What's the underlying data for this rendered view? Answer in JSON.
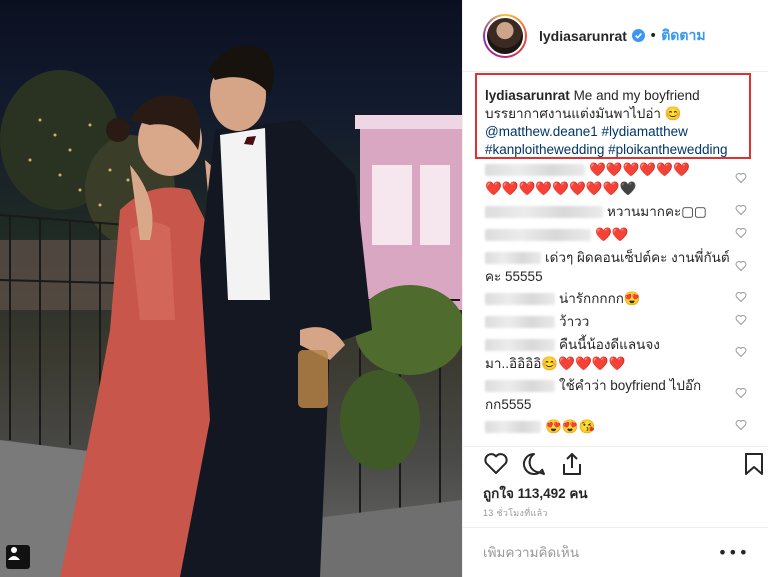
{
  "post": {
    "username": "lydiasarunrat",
    "follow_label": "ติดตาม",
    "separator": "•",
    "caption": {
      "author": "lydiasarunrat",
      "line1": "Me and my boyfriend",
      "line2": "บรรยากาศงานแต่งมันพาไปอ่า 😊",
      "mention1": "@matthew.deane1",
      "tag1": "#lydiamatthew",
      "tag2": "#kanploithewedding",
      "tag3": "#ploikanthewedding"
    },
    "comments": [
      {
        "text": "❤️❤️❤️❤️❤️❤️"
      },
      {
        "text": "❤️❤️❤️❤️❤️❤️❤️❤️🖤"
      },
      {
        "text": "หวานมากคะ▢▢"
      },
      {
        "text": "❤️❤️"
      },
      {
        "text": "เด่วๆ ผิดคอนเซ็ปต์คะ งานพี่กันต์",
        "text2": "คะ 55555"
      },
      {
        "text": "น่ารักกกกก😍"
      },
      {
        "text": "ว้าวว"
      },
      {
        "text": "คืนนี้น้องดีแลนจง",
        "text2": "มา..อิอิอิอิ😊❤️❤️❤️❤️"
      },
      {
        "text": "ใช้คำว่า boyfriend ไปอ๊ก",
        "text2": "กก5555"
      },
      {
        "text": "😍😍😘"
      }
    ],
    "likes_label": "ถูกใจ 113,492 คน",
    "time_ago": "13 ชั่วโมงที่แล้ว",
    "add_comment_placeholder": "เพิ่มความคิดเห็น",
    "more_label": "•••"
  },
  "icons": {
    "verified": "verified-badge-icon",
    "like": "heart-outline-icon",
    "comment": "comment-bubble-icon",
    "share": "share-icon",
    "save": "bookmark-icon",
    "multi": "multi-post-icon"
  },
  "colors": {
    "link": "#003569",
    "follow": "#3897f0",
    "highlight_border": "#e03030",
    "heart": "#e8203a"
  }
}
